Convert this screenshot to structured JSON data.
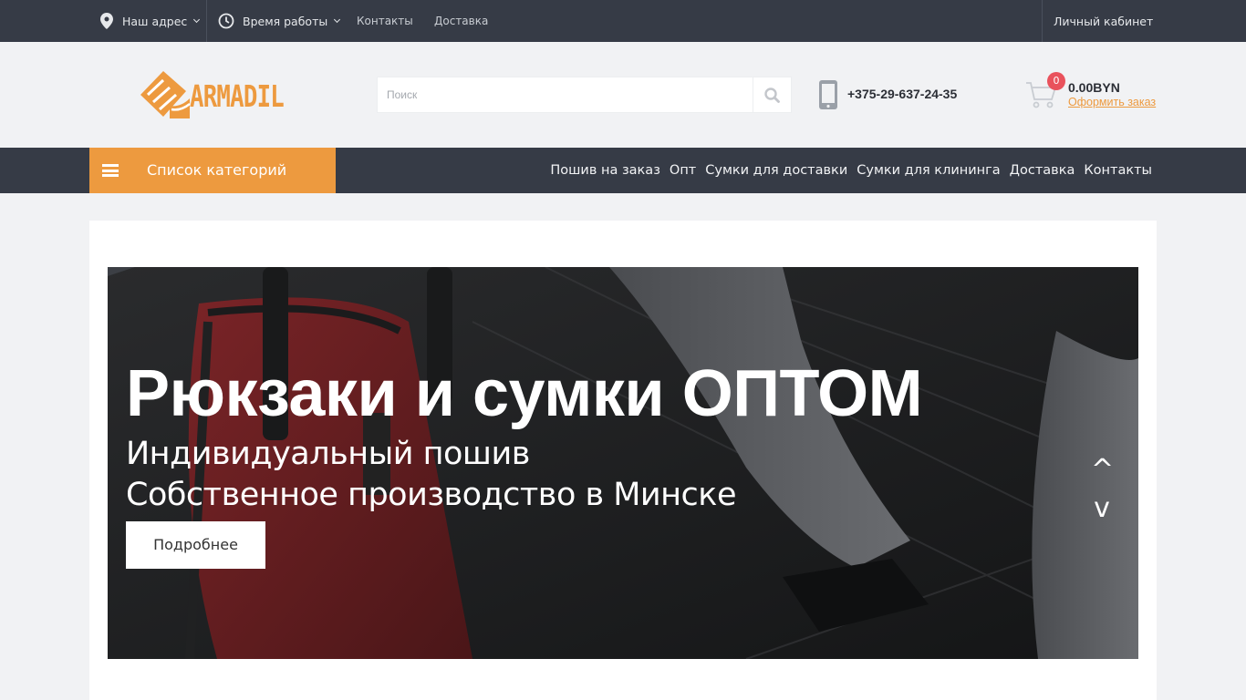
{
  "topbar": {
    "address_label": "Наш адрес",
    "hours_label": "Время работы",
    "contacts_link": "Контакты",
    "delivery_link": "Доставка",
    "account_link": "Личный кабинет"
  },
  "header": {
    "logo_text": "ARMADIL",
    "search_placeholder": "Поиск",
    "phone": "+375-29-637-24-35",
    "cart_count": "0",
    "cart_total": "0.00BYN",
    "checkout_link": "Оформить заказ"
  },
  "nav": {
    "categories_label": "Список категорий",
    "links": [
      "Пошив на заказ",
      "Опт",
      "Сумки для доставки",
      "Сумки для клининга",
      "Доставка",
      "Контакты"
    ]
  },
  "banner": {
    "title": "Рюкзаки и сумки ОПТОМ",
    "subtitle_1": "Индивидуальный пошив",
    "subtitle_2": "Собственное производство в Минске",
    "button_label": "Подробнее",
    "prev_arrow": "^",
    "next_arrow": "v"
  },
  "colors": {
    "accent": "#ed9a3f",
    "dark_bar": "#363b46",
    "badge": "#e9525c"
  }
}
